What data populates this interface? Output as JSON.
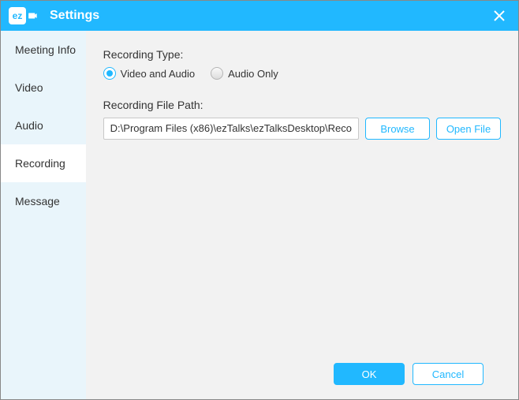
{
  "titlebar": {
    "app_code": "ez",
    "title": "Settings"
  },
  "sidebar": {
    "items": [
      {
        "label": "Meeting Info"
      },
      {
        "label": "Video"
      },
      {
        "label": "Audio"
      },
      {
        "label": "Recording"
      },
      {
        "label": "Message"
      }
    ],
    "active_index": 3
  },
  "main": {
    "recording_type_label": "Recording Type:",
    "options": {
      "video_and_audio": "Video and Audio",
      "audio_only": "Audio Only"
    },
    "selected_option": "video_and_audio",
    "file_path_label": "Recording File Path:",
    "file_path_value": "D:\\Program Files (x86)\\ezTalks\\ezTalksDesktop\\Reco",
    "browse_label": "Browse",
    "open_file_label": "Open File"
  },
  "footer": {
    "ok_label": "OK",
    "cancel_label": "Cancel"
  }
}
